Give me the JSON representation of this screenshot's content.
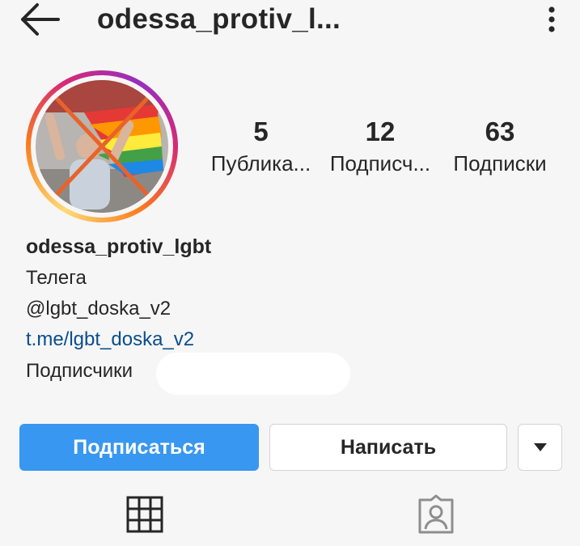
{
  "header": {
    "username_truncated": "odessa_protiv_l...",
    "back_icon": "arrow-left-icon",
    "more_icon": "more-vertical-icon"
  },
  "stats": [
    {
      "value": "5",
      "label": "Публика..."
    },
    {
      "value": "12",
      "label": "Подписч..."
    },
    {
      "value": "63",
      "label": "Подписки"
    }
  ],
  "bio": {
    "name": "odessa_protiv_lgbt",
    "line1": "Телега",
    "line2": "@lgbt_doska_v2",
    "link": "t.me/lgbt_doska_v2",
    "line4": "Подписчики"
  },
  "buttons": {
    "follow": "Подписаться",
    "message": "Написать",
    "dropdown_icon": "caret-down-icon"
  },
  "tabs": [
    {
      "icon": "grid-icon"
    },
    {
      "icon": "tagged-person-icon"
    }
  ],
  "colors": {
    "accent": "#3897f0",
    "link": "#0a4d8c",
    "background": "#f6f6f6"
  }
}
